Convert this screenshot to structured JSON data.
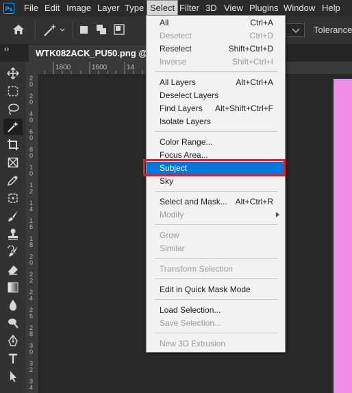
{
  "menubar": {
    "logo": "Ps",
    "items": [
      "File",
      "Edit",
      "Image",
      "Layer",
      "Type",
      "Select",
      "Filter",
      "3D",
      "View",
      "Plugins",
      "Window",
      "Help"
    ]
  },
  "options": {
    "tolerance_label": "Tolerance"
  },
  "document": {
    "tab_title": "WTK082ACK_PU50.png @"
  },
  "rulers": {
    "top": [
      "1800",
      "1600",
      "14"
    ],
    "left": [
      "2\n0",
      "2\n0",
      "4\n0",
      "6\n0",
      "8\n0",
      "1\n0",
      "1\n2",
      "1\n4",
      "1\n6",
      "1\n8",
      "2\n0",
      "2\n2",
      "2\n4",
      "2\n6",
      "2\n8",
      "3\n0",
      "3\n2",
      "3\n4"
    ]
  },
  "select_menu": {
    "items": [
      {
        "label": "All",
        "shortcut": "Ctrl+A",
        "enabled": true
      },
      {
        "label": "Deselect",
        "shortcut": "Ctrl+D",
        "enabled": false
      },
      {
        "label": "Reselect",
        "shortcut": "Shift+Ctrl+D",
        "enabled": true
      },
      {
        "label": "Inverse",
        "shortcut": "Shift+Ctrl+I",
        "enabled": false
      },
      {
        "label": "All Layers",
        "shortcut": "Alt+Ctrl+A",
        "enabled": true
      },
      {
        "label": "Deselect Layers",
        "shortcut": "",
        "enabled": true
      },
      {
        "label": "Find Layers",
        "shortcut": "Alt+Shift+Ctrl+F",
        "enabled": true
      },
      {
        "label": "Isolate Layers",
        "shortcut": "",
        "enabled": true
      },
      {
        "label": "Color Range...",
        "shortcut": "",
        "enabled": true
      },
      {
        "label": "Focus Area...",
        "shortcut": "",
        "enabled": true
      },
      {
        "label": "Subject",
        "shortcut": "",
        "enabled": true,
        "highlighted": true
      },
      {
        "label": "Sky",
        "shortcut": "",
        "enabled": true
      },
      {
        "label": "Select and Mask...",
        "shortcut": "Alt+Ctrl+R",
        "enabled": true
      },
      {
        "label": "Modify",
        "shortcut": "",
        "enabled": false,
        "submenu": true
      },
      {
        "label": "Grow",
        "shortcut": "",
        "enabled": false
      },
      {
        "label": "Similar",
        "shortcut": "",
        "enabled": false
      },
      {
        "label": "Transform Selection",
        "shortcut": "",
        "enabled": false
      },
      {
        "label": "Edit in Quick Mask Mode",
        "shortcut": "",
        "enabled": true
      },
      {
        "label": "Load Selection...",
        "shortcut": "",
        "enabled": true
      },
      {
        "label": "Save Selection...",
        "shortcut": "",
        "enabled": false
      },
      {
        "label": "New 3D Extrusion",
        "shortcut": "",
        "enabled": false
      }
    ]
  },
  "colors": {
    "highlight": "#0078d7",
    "callout": "#d8232a",
    "canvas_pink": "#f08ce8"
  }
}
